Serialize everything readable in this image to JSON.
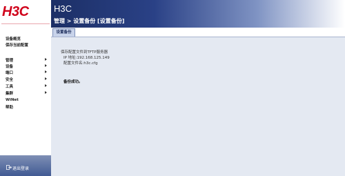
{
  "logo": "H3C",
  "header": {
    "app_title": "H3C",
    "breadcrumb": "管理 > 设置备份 [设置备份]"
  },
  "sidebar": {
    "top_links": [
      {
        "label": "设备概览"
      },
      {
        "label": "保存当前配置"
      }
    ],
    "menu": [
      {
        "label": "管理",
        "has_submenu": true
      },
      {
        "label": "设备",
        "has_submenu": true
      },
      {
        "label": "端口",
        "has_submenu": true
      },
      {
        "label": "安全",
        "has_submenu": true
      },
      {
        "label": "工具",
        "has_submenu": true
      },
      {
        "label": "集群",
        "has_submenu": true
      },
      {
        "label": "WiNet",
        "has_submenu": false
      },
      {
        "label": "帮助",
        "has_submenu": false
      }
    ],
    "logout_label": "退出登录"
  },
  "tabs": [
    {
      "label": "设置备份",
      "active": true
    }
  ],
  "content": {
    "heading": "保存配置文件到TFTP服务器",
    "ip_line": "IP 地址:192.168.125.149",
    "file_line": "配置文件名:h3c.cfg",
    "result": "备份成功。"
  },
  "colors": {
    "logo_red": "#d0021b",
    "header_dark": "#1c2f66",
    "content_bg": "#e4e9f2",
    "tab_bg": "#c8d3ea"
  }
}
